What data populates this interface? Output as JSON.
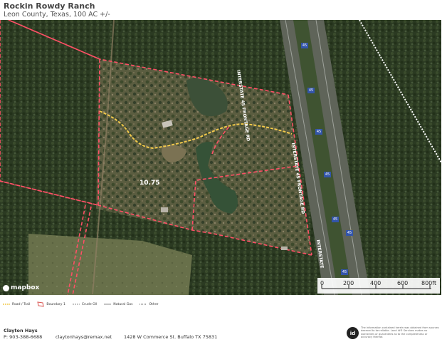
{
  "header": {
    "title": "Rockin Rowdy Ranch",
    "subtitle": "Leon County, Texas, 100 AC +/-"
  },
  "map": {
    "parcel_label": "10.75",
    "road_labels": {
      "frontage_north": "INTERSTATE 45 FRONTAGE RD",
      "frontage_south": "INTERSTATE 45 FRONTAGE RD",
      "interstate": "INTERSTATE"
    },
    "shield_text": "45",
    "attribution": "mapbox",
    "scale": {
      "ticks": [
        "0",
        "200",
        "400",
        "600",
        "800ft"
      ]
    }
  },
  "legend": {
    "items": [
      {
        "label": "Road / Trail",
        "icon": "road-trail-line",
        "color": "#f2c94c"
      },
      {
        "label": "Boundary 1",
        "icon": "boundary-polygon",
        "color": "#d9534f"
      },
      {
        "label": "Crude Oil",
        "icon": "crude-oil-line",
        "color": "#888888"
      },
      {
        "label": "Natural Gas",
        "icon": "natural-gas-line",
        "color": "#888888"
      },
      {
        "label": "Other",
        "icon": "other-line",
        "color": "#555555"
      }
    ]
  },
  "footer": {
    "agent_name": "Clayton Hays",
    "phone": "P: 903-388-6688",
    "email": "claytonhays@remax.net",
    "address": "1428 W Commerce St.  Buffalo TX 75831",
    "logo_text": "id",
    "disclaimer": "The information contained herein was obtained from sources deemed to be reliable. Land id® Services makes no warranties or guarantees as to the completeness or accuracy thereof."
  },
  "colors": {
    "boundary": "#e0304a",
    "trail": "#f2c94c",
    "forest": "#27361f",
    "interstate": "#6f7470"
  }
}
